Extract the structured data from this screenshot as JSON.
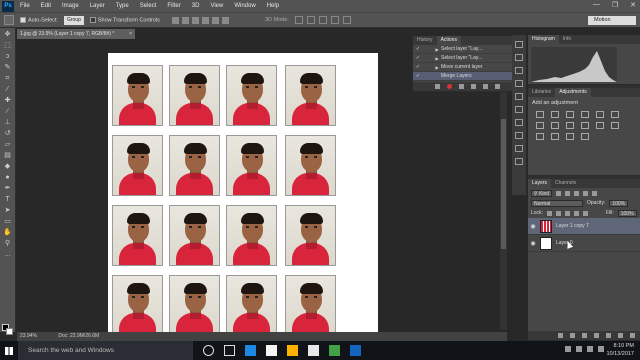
{
  "app": {
    "logo_text": "Ps"
  },
  "menu": [
    "File",
    "Edit",
    "Image",
    "Layer",
    "Type",
    "Select",
    "Filter",
    "3D",
    "View",
    "Window",
    "Help"
  ],
  "window_controls": {
    "minimize": "—",
    "restore": "❐",
    "close": "✕"
  },
  "options": {
    "auto_select_label": "Auto-Select:",
    "auto_select_value": "Group",
    "show_transform_label": "Show Transform Controls",
    "mode3d_label": "3D Mode:",
    "workspace": "Motion"
  },
  "document": {
    "tab_title": "1.jpg @ 23.9% (Layer 1 copy 7, RGB/8#) *",
    "tab_close": "×",
    "photo_rows": 4,
    "photo_cols": 4
  },
  "status": {
    "zoom": "23.94%",
    "doc": "Doc: 22.9M/26.6M"
  },
  "history_panel": {
    "tabs": [
      "History",
      "Actions"
    ],
    "active_tab": "Actions",
    "actions": [
      {
        "label": "Select layer \"Lay...",
        "selected": false
      },
      {
        "label": "Select layer \"Lay...",
        "selected": false
      },
      {
        "label": "Move current layer",
        "selected": false
      },
      {
        "label": "Merge Layers",
        "selected": true
      }
    ]
  },
  "histogram_panel": {
    "tabs": [
      "Histogram",
      "Info"
    ],
    "active_tab": "Histogram"
  },
  "adjustments_panel": {
    "tabs": [
      "Libraries",
      "Adjustments"
    ],
    "active_tab": "Adjustments",
    "title": "Add an adjustment",
    "icon_count": 16
  },
  "layers_panel": {
    "tabs": [
      "Layers",
      "Channels"
    ],
    "active_tab": "Layers",
    "kind_filter": "Kind",
    "blend_mode": "Normal",
    "opacity_label": "Opacity:",
    "opacity_value": "100%",
    "lock_label": "Lock:",
    "fill_label": "Fill:",
    "fill_value": "100%",
    "layers": [
      {
        "name": "Layer 1 copy 7",
        "selected": true
      },
      {
        "name": "Layer 0",
        "selected": false
      }
    ]
  },
  "taskbar": {
    "search_placeholder": "Search the web and Windows",
    "time": "8:10 PM",
    "date": "10/13/2017",
    "app_icon_colors": [
      "#1e88e5",
      "#f4f4f4",
      "#ffb300",
      "#e8e8e8",
      "#43a047",
      "#1565c0"
    ]
  }
}
